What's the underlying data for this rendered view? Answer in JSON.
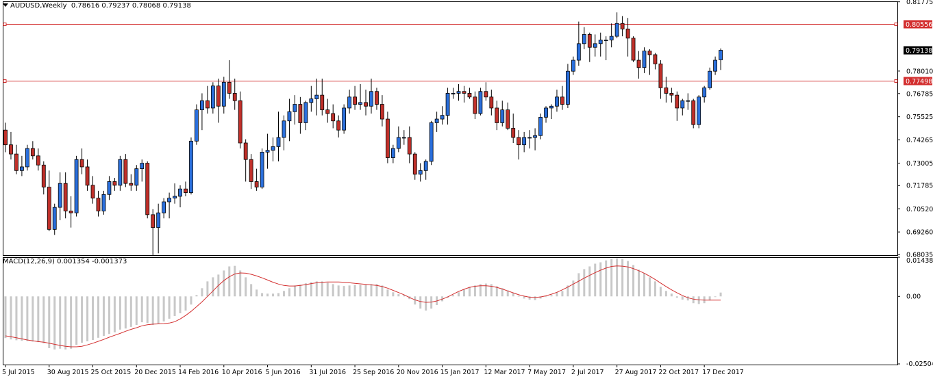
{
  "header": {
    "symbol": "AUDUSD,Weekly",
    "ohlc": "0.78616 0.79237 0.78068 0.79138"
  },
  "macd_header": {
    "label": "MACD(12,26,9)",
    "values": "0.001354 -0.001373"
  },
  "colors": {
    "bull": "#2a6fdc",
    "bear": "#c0302a",
    "level_line": "#d32f2f",
    "histogram": "#c8c8c8",
    "signal": "#d32f2f",
    "current_price_bg": "#000000"
  },
  "chart_data": [
    {
      "type": "candlestick",
      "title": "AUDUSD,Weekly",
      "timeframe": "Weekly",
      "ylim": [
        0.68,
        0.818
      ],
      "y_ticks": [
        "0.81775",
        "0.80556",
        "0.79138",
        "0.78010",
        "0.77498",
        "0.76785",
        "0.75525",
        "0.74265",
        "0.73005",
        "0.71785",
        "0.70520",
        "0.69260",
        "0.68035"
      ],
      "x_tick_labels": [
        "5 Jul 2015",
        "30 Aug 2015",
        "25 Oct 2015",
        "20 Dec 2015",
        "14 Feb 2016",
        "10 Apr 2016",
        "5 Jun 2016",
        "31 Jul 2016",
        "25 Sep 2016",
        "20 Nov 2016",
        "15 Jan 2017",
        "12 Mar 2017",
        "7 May 2017",
        "2 Jul 2017",
        "27 Aug 2017",
        "22 Oct 2017",
        "17 Dec 2017"
      ],
      "horizontal_lines": [
        {
          "price": 0.80556,
          "label": "0.80556"
        },
        {
          "price": 0.77498,
          "label": "0.77498"
        }
      ],
      "current_price": {
        "value": 0.79138,
        "label": "0.79138"
      },
      "candles": [
        [
          0.748,
          0.752,
          0.736,
          0.74
        ],
        [
          0.74,
          0.747,
          0.732,
          0.735
        ],
        [
          0.735,
          0.74,
          0.724,
          0.726
        ],
        [
          0.726,
          0.734,
          0.723,
          0.728
        ],
        [
          0.728,
          0.74,
          0.726,
          0.738
        ],
        [
          0.738,
          0.742,
          0.732,
          0.734
        ],
        [
          0.734,
          0.738,
          0.726,
          0.729
        ],
        [
          0.729,
          0.731,
          0.713,
          0.717
        ],
        [
          0.717,
          0.726,
          0.693,
          0.694
        ],
        [
          0.694,
          0.708,
          0.691,
          0.706
        ],
        [
          0.706,
          0.725,
          0.699,
          0.719
        ],
        [
          0.719,
          0.725,
          0.7,
          0.704
        ],
        [
          0.704,
          0.712,
          0.695,
          0.703
        ],
        [
          0.703,
          0.734,
          0.701,
          0.732
        ],
        [
          0.732,
          0.738,
          0.724,
          0.728
        ],
        [
          0.728,
          0.732,
          0.715,
          0.718
        ],
        [
          0.718,
          0.723,
          0.708,
          0.711
        ],
        [
          0.711,
          0.715,
          0.701,
          0.704
        ],
        [
          0.704,
          0.715,
          0.702,
          0.713
        ],
        [
          0.713,
          0.723,
          0.71,
          0.72
        ],
        [
          0.72,
          0.722,
          0.715,
          0.718
        ],
        [
          0.718,
          0.734,
          0.715,
          0.732
        ],
        [
          0.732,
          0.735,
          0.717,
          0.719
        ],
        [
          0.719,
          0.724,
          0.715,
          0.718
        ],
        [
          0.718,
          0.729,
          0.715,
          0.727
        ],
        [
          0.727,
          0.732,
          0.72,
          0.73
        ],
        [
          0.73,
          0.731,
          0.7,
          0.702
        ],
        [
          0.702,
          0.705,
          0.68,
          0.695
        ],
        [
          0.695,
          0.708,
          0.681,
          0.703
        ],
        [
          0.703,
          0.711,
          0.7,
          0.709
        ],
        [
          0.709,
          0.714,
          0.7,
          0.711
        ],
        [
          0.711,
          0.719,
          0.708,
          0.712
        ],
        [
          0.712,
          0.718,
          0.706,
          0.716
        ],
        [
          0.716,
          0.72,
          0.712,
          0.714
        ],
        [
          0.714,
          0.744,
          0.713,
          0.742
        ],
        [
          0.742,
          0.762,
          0.74,
          0.759
        ],
        [
          0.759,
          0.768,
          0.748,
          0.764
        ],
        [
          0.764,
          0.772,
          0.757,
          0.76
        ],
        [
          0.76,
          0.774,
          0.757,
          0.772
        ],
        [
          0.772,
          0.776,
          0.752,
          0.761
        ],
        [
          0.761,
          0.777,
          0.757,
          0.774
        ],
        [
          0.774,
          0.786,
          0.765,
          0.768
        ],
        [
          0.768,
          0.776,
          0.759,
          0.764
        ],
        [
          0.764,
          0.769,
          0.738,
          0.741
        ],
        [
          0.741,
          0.743,
          0.72,
          0.732
        ],
        [
          0.732,
          0.735,
          0.716,
          0.72
        ],
        [
          0.72,
          0.727,
          0.715,
          0.717
        ],
        [
          0.717,
          0.738,
          0.716,
          0.736
        ],
        [
          0.736,
          0.746,
          0.727,
          0.737
        ],
        [
          0.737,
          0.744,
          0.731,
          0.739
        ],
        [
          0.739,
          0.758,
          0.731,
          0.744
        ],
        [
          0.744,
          0.756,
          0.737,
          0.753
        ],
        [
          0.753,
          0.765,
          0.742,
          0.758
        ],
        [
          0.758,
          0.767,
          0.751,
          0.762
        ],
        [
          0.762,
          0.766,
          0.746,
          0.752
        ],
        [
          0.752,
          0.764,
          0.748,
          0.763
        ],
        [
          0.763,
          0.772,
          0.758,
          0.765
        ],
        [
          0.765,
          0.776,
          0.756,
          0.767
        ],
        [
          0.767,
          0.776,
          0.756,
          0.759
        ],
        [
          0.759,
          0.765,
          0.752,
          0.757
        ],
        [
          0.757,
          0.762,
          0.749,
          0.753
        ],
        [
          0.753,
          0.756,
          0.744,
          0.748
        ],
        [
          0.748,
          0.762,
          0.746,
          0.76
        ],
        [
          0.76,
          0.77,
          0.757,
          0.766
        ],
        [
          0.766,
          0.772,
          0.759,
          0.762
        ],
        [
          0.762,
          0.773,
          0.759,
          0.763
        ],
        [
          0.763,
          0.77,
          0.756,
          0.761
        ],
        [
          0.761,
          0.776,
          0.757,
          0.769
        ],
        [
          0.769,
          0.771,
          0.759,
          0.762
        ],
        [
          0.762,
          0.767,
          0.75,
          0.754
        ],
        [
          0.754,
          0.758,
          0.73,
          0.733
        ],
        [
          0.733,
          0.74,
          0.73,
          0.738
        ],
        [
          0.738,
          0.75,
          0.736,
          0.744
        ],
        [
          0.744,
          0.748,
          0.74,
          0.744
        ],
        [
          0.744,
          0.75,
          0.73,
          0.735
        ],
        [
          0.735,
          0.736,
          0.721,
          0.724
        ],
        [
          0.724,
          0.73,
          0.72,
          0.726
        ],
        [
          0.726,
          0.732,
          0.721,
          0.731
        ],
        [
          0.731,
          0.753,
          0.729,
          0.752
        ],
        [
          0.752,
          0.758,
          0.747,
          0.754
        ],
        [
          0.754,
          0.761,
          0.751,
          0.756
        ],
        [
          0.756,
          0.771,
          0.751,
          0.768
        ],
        [
          0.768,
          0.771,
          0.765,
          0.768
        ],
        [
          0.768,
          0.773,
          0.764,
          0.769
        ],
        [
          0.769,
          0.772,
          0.763,
          0.768
        ],
        [
          0.768,
          0.771,
          0.765,
          0.766
        ],
        [
          0.766,
          0.769,
          0.754,
          0.757
        ],
        [
          0.757,
          0.771,
          0.756,
          0.769
        ],
        [
          0.769,
          0.774,
          0.764,
          0.766
        ],
        [
          0.766,
          0.77,
          0.756,
          0.76
        ],
        [
          0.76,
          0.764,
          0.748,
          0.752
        ],
        [
          0.752,
          0.764,
          0.75,
          0.759
        ],
        [
          0.759,
          0.763,
          0.748,
          0.749
        ],
        [
          0.749,
          0.757,
          0.741,
          0.744
        ],
        [
          0.744,
          0.748,
          0.732,
          0.74
        ],
        [
          0.74,
          0.747,
          0.736,
          0.744
        ],
        [
          0.744,
          0.748,
          0.738,
          0.744
        ],
        [
          0.744,
          0.749,
          0.737,
          0.745
        ],
        [
          0.745,
          0.757,
          0.743,
          0.755
        ],
        [
          0.755,
          0.761,
          0.752,
          0.76
        ],
        [
          0.76,
          0.762,
          0.754,
          0.761
        ],
        [
          0.761,
          0.77,
          0.758,
          0.766
        ],
        [
          0.766,
          0.772,
          0.759,
          0.762
        ],
        [
          0.762,
          0.784,
          0.76,
          0.78
        ],
        [
          0.78,
          0.788,
          0.778,
          0.786
        ],
        [
          0.786,
          0.807,
          0.783,
          0.795
        ],
        [
          0.795,
          0.804,
          0.792,
          0.8
        ],
        [
          0.8,
          0.801,
          0.785,
          0.793
        ],
        [
          0.793,
          0.8,
          0.788,
          0.795
        ],
        [
          0.795,
          0.801,
          0.788,
          0.797
        ],
        [
          0.797,
          0.799,
          0.786,
          0.797
        ],
        [
          0.797,
          0.806,
          0.793,
          0.799
        ],
        [
          0.799,
          0.812,
          0.798,
          0.806
        ],
        [
          0.806,
          0.81,
          0.799,
          0.803
        ],
        [
          0.803,
          0.809,
          0.788,
          0.798
        ],
        [
          0.798,
          0.799,
          0.785,
          0.786
        ],
        [
          0.786,
          0.791,
          0.776,
          0.782
        ],
        [
          0.782,
          0.793,
          0.779,
          0.791
        ],
        [
          0.791,
          0.792,
          0.778,
          0.789
        ],
        [
          0.789,
          0.79,
          0.781,
          0.784
        ],
        [
          0.784,
          0.786,
          0.765,
          0.771
        ],
        [
          0.771,
          0.777,
          0.763,
          0.768
        ],
        [
          0.768,
          0.771,
          0.763,
          0.767
        ],
        [
          0.767,
          0.769,
          0.753,
          0.76
        ],
        [
          0.76,
          0.765,
          0.756,
          0.764
        ],
        [
          0.764,
          0.768,
          0.759,
          0.764
        ],
        [
          0.764,
          0.765,
          0.749,
          0.751
        ],
        [
          0.751,
          0.767,
          0.749,
          0.766
        ],
        [
          0.766,
          0.772,
          0.763,
          0.771
        ],
        [
          0.771,
          0.782,
          0.77,
          0.78
        ],
        [
          0.78,
          0.788,
          0.778,
          0.786
        ],
        [
          0.7862,
          0.7924,
          0.7807,
          0.7914
        ]
      ]
    },
    {
      "type": "bar+line",
      "title": "MACD(12,26,9)",
      "ylim": [
        -0.02504,
        0.01438
      ],
      "y_ticks": [
        "0.014384",
        "0.00",
        "-0.025046"
      ],
      "series": [
        {
          "name": "MACD",
          "kind": "histogram",
          "values": [
            -0.0153,
            -0.0158,
            -0.0161,
            -0.0163,
            -0.0164,
            -0.0166,
            -0.0168,
            -0.0172,
            -0.019,
            -0.0195,
            -0.0192,
            -0.0195,
            -0.0192,
            -0.0178,
            -0.017,
            -0.0165,
            -0.016,
            -0.0152,
            -0.0145,
            -0.0138,
            -0.0132,
            -0.0122,
            -0.0118,
            -0.0112,
            -0.0105,
            -0.0095,
            -0.0098,
            -0.0105,
            -0.01,
            -0.0092,
            -0.0082,
            -0.0072,
            -0.0062,
            -0.0052,
            -0.003,
            0.0005,
            0.003,
            0.0055,
            0.007,
            0.008,
            0.0095,
            0.011,
            0.0112,
            0.0095,
            0.007,
            0.0045,
            0.0025,
            0.0012,
            0.001,
            0.001,
            0.0012,
            0.002,
            0.003,
            0.004,
            0.0043,
            0.0048,
            0.0052,
            0.0055,
            0.0055,
            0.005,
            0.0045,
            0.004,
            0.0038,
            0.004,
            0.0042,
            0.0042,
            0.0042,
            0.0045,
            0.0045,
            0.004,
            0.0025,
            0.0015,
            0.0008,
            0.0005,
            -0.001,
            -0.003,
            -0.0045,
            -0.0052,
            -0.0045,
            -0.0032,
            -0.0018,
            -0.0005,
            0.0005,
            0.0015,
            0.0025,
            0.0035,
            0.004,
            0.0045,
            0.0047,
            0.0045,
            0.0037,
            0.003,
            0.0022,
            0.0012,
            0.0002,
            -0.0008,
            -0.0012,
            -0.0014,
            -0.0008,
            0.0,
            0.0005,
            0.0015,
            0.002,
            0.004,
            0.0058,
            0.0085,
            0.01,
            0.011,
            0.012,
            0.0125,
            0.0132,
            0.0138,
            0.014,
            0.0138,
            0.013,
            0.0115,
            0.0098,
            0.0085,
            0.007,
            0.0055,
            0.0035,
            0.002,
            0.001,
            -0.0005,
            -0.0012,
            -0.0015,
            -0.0025,
            -0.0028,
            -0.0025,
            -0.0015,
            -0.0002,
            0.0014
          ]
        },
        {
          "name": "Signal",
          "kind": "line",
          "values": [
            -0.0145,
            -0.0148,
            -0.0152,
            -0.0156,
            -0.016,
            -0.0163,
            -0.0166,
            -0.0168,
            -0.0172,
            -0.0176,
            -0.018,
            -0.0183,
            -0.0185,
            -0.0185,
            -0.0183,
            -0.0178,
            -0.0172,
            -0.0165,
            -0.0158,
            -0.015,
            -0.0143,
            -0.0136,
            -0.0128,
            -0.0121,
            -0.0115,
            -0.0108,
            -0.0104,
            -0.0102,
            -0.0101,
            -0.01,
            -0.0098,
            -0.0093,
            -0.0083,
            -0.007,
            -0.0055,
            -0.0038,
            -0.002,
            0.0,
            0.002,
            0.004,
            0.0058,
            0.0072,
            0.0082,
            0.0086,
            0.0085,
            0.0081,
            0.0075,
            0.0068,
            0.006,
            0.0052,
            0.0045,
            0.004,
            0.0038,
            0.0038,
            0.004,
            0.0043,
            0.0047,
            0.005,
            0.0052,
            0.0053,
            0.0053,
            0.0053,
            0.0052,
            0.005,
            0.0048,
            0.0046,
            0.0044,
            0.0042,
            0.004,
            0.0036,
            0.003,
            0.0022,
            0.0014,
            0.0006,
            -0.0004,
            -0.0013,
            -0.0019,
            -0.0022,
            -0.0021,
            -0.0017,
            -0.001,
            -0.0002,
            0.0008,
            0.0018,
            0.0026,
            0.0033,
            0.0037,
            0.0039,
            0.0039,
            0.0037,
            0.0033,
            0.0027,
            0.002,
            0.0013,
            0.0006,
            0.0001,
            -0.0003,
            -0.0004,
            -0.0002,
            0.0002,
            0.0008,
            0.0015,
            0.0024,
            0.0034,
            0.0045,
            0.0056,
            0.0067,
            0.0077,
            0.0087,
            0.0096,
            0.0104,
            0.011,
            0.0112,
            0.0111,
            0.0108,
            0.0102,
            0.0094,
            0.0085,
            0.0074,
            0.0062,
            0.0049,
            0.0036,
            0.0024,
            0.0013,
            0.0003,
            -0.0005,
            -0.001,
            -0.0013,
            -0.0014,
            -0.0014,
            -0.0014,
            -0.0014
          ]
        }
      ]
    }
  ]
}
